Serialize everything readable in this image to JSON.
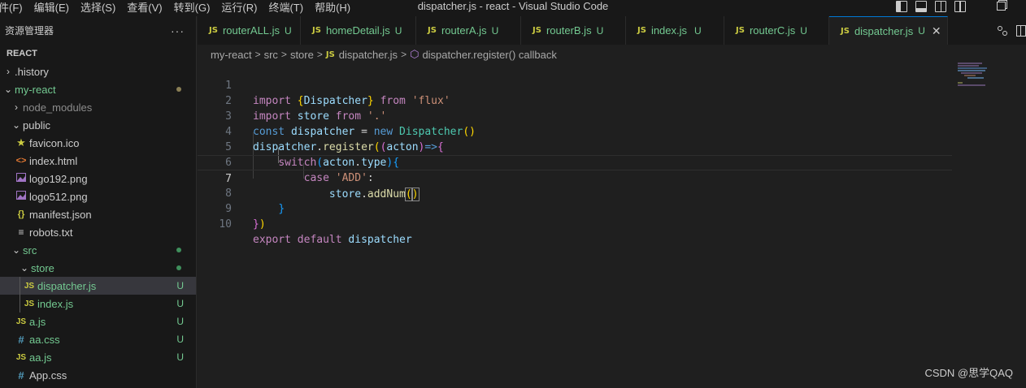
{
  "titlebar": {
    "menus": [
      "件(F)",
      "编辑(E)",
      "选择(S)",
      "查看(V)",
      "转到(G)",
      "运行(R)",
      "终端(T)",
      "帮助(H)"
    ],
    "title": "dispatcher.js - react - Visual Studio Code"
  },
  "sidebar": {
    "title": "资源管理器",
    "more": "···",
    "root": "REACT",
    "items": [
      {
        "label": ".history",
        "chevron": ">",
        "icon": "",
        "status": ""
      },
      {
        "label": "my-react",
        "chevron": "v",
        "icon": "",
        "status": "dot"
      },
      {
        "label": "node_modules",
        "chevron": ">",
        "icon": "",
        "status": ""
      },
      {
        "label": "public",
        "chevron": "v",
        "icon": "",
        "status": ""
      },
      {
        "label": "favicon.ico",
        "chevron": "",
        "icon": "star-icon",
        "status": ""
      },
      {
        "label": "index.html",
        "chevron": "",
        "icon": "html-icon",
        "status": ""
      },
      {
        "label": "logo192.png",
        "chevron": "",
        "icon": "image-icon",
        "status": ""
      },
      {
        "label": "logo512.png",
        "chevron": "",
        "icon": "image-icon",
        "status": ""
      },
      {
        "label": "manifest.json",
        "chevron": "",
        "icon": "json-icon",
        "status": ""
      },
      {
        "label": "robots.txt",
        "chevron": "",
        "icon": "text-icon",
        "status": ""
      },
      {
        "label": "src",
        "chevron": "v",
        "icon": "",
        "status": "dot"
      },
      {
        "label": "store",
        "chevron": "v",
        "icon": "",
        "status": "dot"
      },
      {
        "label": "dispatcher.js",
        "chevron": "",
        "icon": "js-icon",
        "status": "U"
      },
      {
        "label": "index.js",
        "chevron": "",
        "icon": "js-icon",
        "status": "U"
      },
      {
        "label": "a.js",
        "chevron": "",
        "icon": "js-icon",
        "status": "U"
      },
      {
        "label": "aa.css",
        "chevron": "",
        "icon": "css-icon",
        "status": "U"
      },
      {
        "label": "aa.js",
        "chevron": "",
        "icon": "js-icon",
        "status": "U"
      },
      {
        "label": "App.css",
        "chevron": "",
        "icon": "css-icon",
        "status": ""
      }
    ]
  },
  "tabs": [
    {
      "label": "routerALL.js",
      "status": "U",
      "active": false
    },
    {
      "label": "homeDetail.js",
      "status": "U",
      "active": false
    },
    {
      "label": "routerA.js",
      "status": "U",
      "active": false
    },
    {
      "label": "routerB.js",
      "status": "U",
      "active": false
    },
    {
      "label": "index.js",
      "status": "U",
      "active": false
    },
    {
      "label": "routerC.js",
      "status": "U",
      "active": false
    },
    {
      "label": "dispatcher.js",
      "status": "U",
      "active": true
    }
  ],
  "tab_icon_text": "JS",
  "tab_close": "✕",
  "breadcrumb": {
    "parts": [
      "my-react",
      "src",
      "store",
      "dispatcher.js",
      "dispatcher.register() callback"
    ]
  },
  "editor": {
    "current_line": 7,
    "line_numbers": [
      "1",
      "2",
      "3",
      "4",
      "5",
      "6",
      "7",
      "8",
      "9",
      "10"
    ]
  },
  "watermark": "CSDN @思学QAQ",
  "colors": {
    "accent": "#0078d4",
    "untracked": "#73c991",
    "js_icon": "#cbcb41"
  }
}
